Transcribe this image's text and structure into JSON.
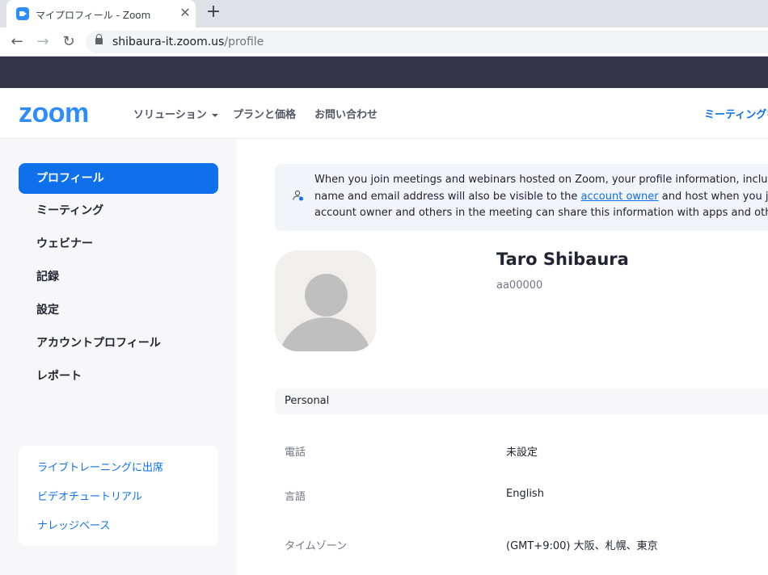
{
  "browser": {
    "tab_title": "マイプロフィール - Zoom",
    "tab_close": "✕",
    "new_tab": "+",
    "nav_back": "←",
    "nav_forward": "→",
    "nav_reload": "↻",
    "url_host": "shibaura-it.zoom.us",
    "url_path": "/profile"
  },
  "header": {
    "logo": "zoom",
    "menu": {
      "solutions": "ソリューション",
      "plans": "プランと価格",
      "contact": "お問い合わせ",
      "join": "ミーティングを"
    }
  },
  "sidebar": {
    "items": [
      {
        "label": "プロフィール",
        "active": true
      },
      {
        "label": "ミーティング"
      },
      {
        "label": "ウェビナー"
      },
      {
        "label": "記録"
      },
      {
        "label": "設定"
      },
      {
        "label": "アカウントプロフィール"
      },
      {
        "label": "レポート"
      }
    ],
    "help": [
      {
        "label": "ライブトレーニングに出席"
      },
      {
        "label": "ビデオチュートリアル"
      },
      {
        "label": "ナレッジベース"
      }
    ]
  },
  "notice": {
    "line1": "When you join meetings and webinars hosted on Zoom, your profile information, including you",
    "line2_pre": "name and email address will also be visible to the ",
    "line2_link": "account owner",
    "line2_post": " and host when you join meet",
    "line3": "account owner and others in the meeting can share this information with apps and others."
  },
  "profile": {
    "name": "Taro Shibaura",
    "id": "aa00000"
  },
  "personal": {
    "section_label": "Personal",
    "rows": [
      {
        "label": "電話",
        "value": "未設定"
      },
      {
        "label": "言語",
        "value": "English"
      },
      {
        "label": "タイムゾーン",
        "value": "(GMT+9:00) 大阪、札幌、東京"
      }
    ]
  },
  "colors": {
    "accent": "#0e71eb",
    "brand": "#2d8cff",
    "dark_bar": "#34354a"
  }
}
